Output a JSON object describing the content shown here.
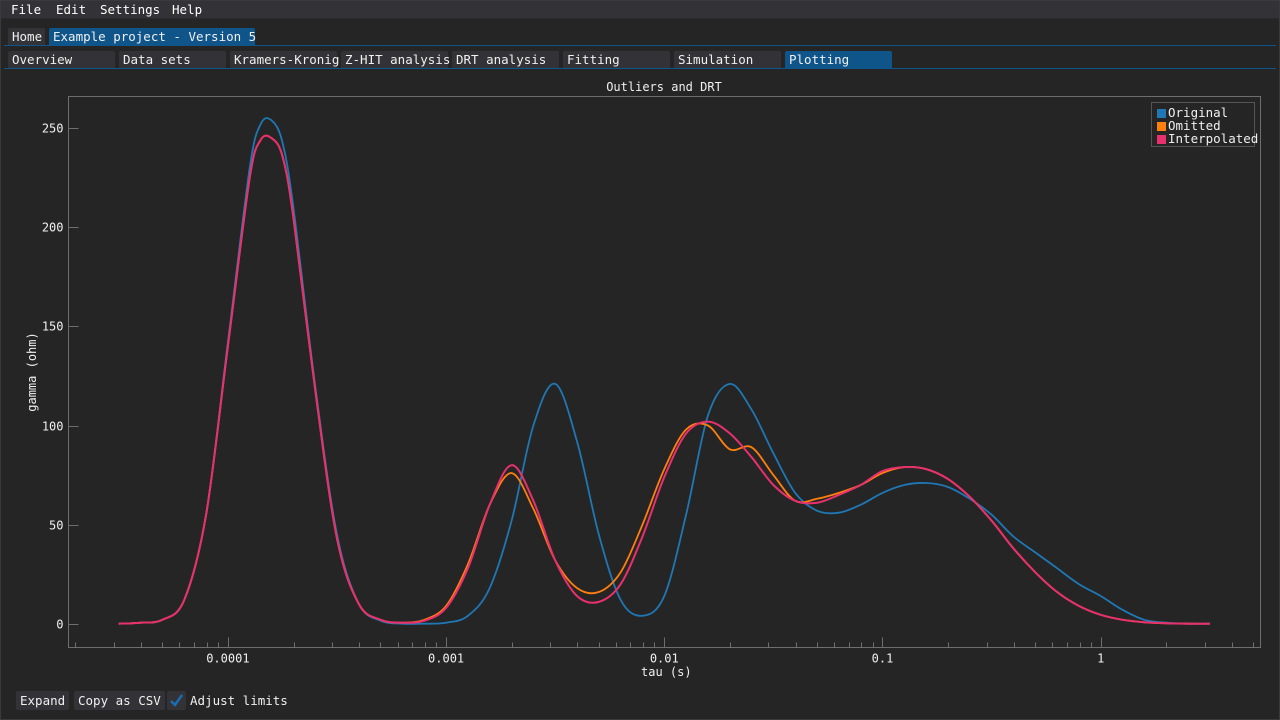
{
  "menu": {
    "items": [
      {
        "label": "File"
      },
      {
        "label": "Edit"
      },
      {
        "label": "Settings"
      },
      {
        "label": "Help"
      }
    ]
  },
  "project_tabs": [
    {
      "label": "Home",
      "active": false
    },
    {
      "label": "Example project - Version 5",
      "active": true
    }
  ],
  "section_tabs": [
    {
      "label": "Overview",
      "active": false
    },
    {
      "label": "Data sets",
      "active": false
    },
    {
      "label": "Kramers-Kronig",
      "active": false
    },
    {
      "label": "Z-HIT analysis",
      "active": false
    },
    {
      "label": "DRT analysis",
      "active": false
    },
    {
      "label": "Fitting",
      "active": false
    },
    {
      "label": "Simulation",
      "active": false
    },
    {
      "label": "Plotting",
      "active": true
    }
  ],
  "bottom_controls": {
    "expand_label": "Expand",
    "copy_csv_label": "Copy as CSV",
    "adjust_limits_label": "Adjust limits",
    "adjust_limits_checked": true
  },
  "colors": {
    "accent": "#10558a",
    "background": "#252525",
    "panel": "#333337"
  },
  "chart_data": {
    "type": "line",
    "title": "Outliers and DRT",
    "xlabel": "tau (s)",
    "ylabel": "gamma (ohm)",
    "xscale": "log",
    "xlim": [
      1.86e-05,
      5.4
    ],
    "ylim": [
      -12,
      266
    ],
    "xticks": [
      0.0001,
      0.001,
      0.01,
      0.1,
      1
    ],
    "xtick_labels": [
      "0.0001",
      "0.001",
      "0.01",
      "0.1",
      "1"
    ],
    "yticks": [
      0,
      50,
      100,
      150,
      200,
      250
    ],
    "ytick_labels": [
      "0",
      "50",
      "100",
      "150",
      "200",
      "250"
    ],
    "grid": false,
    "legend_position": "top-right",
    "log10_tau": [
      -4.5,
      -4.4,
      -4.3,
      -4.2,
      -4.1,
      -4.0,
      -3.9,
      -3.85,
      -3.8,
      -3.75,
      -3.7,
      -3.6,
      -3.5,
      -3.4,
      -3.3,
      -3.2,
      -3.1,
      -3.0,
      -2.9,
      -2.8,
      -2.7,
      -2.6,
      -2.5,
      -2.4,
      -2.3,
      -2.2,
      -2.1,
      -2.0,
      -1.9,
      -1.8,
      -1.7,
      -1.6,
      -1.5,
      -1.4,
      -1.3,
      -1.2,
      -1.1,
      -1.0,
      -0.9,
      -0.8,
      -0.7,
      -0.6,
      -0.5,
      -0.4,
      -0.3,
      -0.2,
      -0.1,
      0.0,
      0.1,
      0.2,
      0.3,
      0.4,
      0.5
    ],
    "series": [
      {
        "name": "Original",
        "color": "#1f77b4",
        "values": [
          0,
          0.5,
          2,
          12,
          55,
          142,
          230,
          252,
          254,
          243,
          210,
          120,
          45,
          10,
          1.5,
          0,
          0,
          0.5,
          4,
          18,
          52,
          100,
          121,
          92,
          45,
          12,
          4,
          14,
          55,
          105,
          121,
          108,
          86,
          66,
          57,
          56,
          60,
          66,
          70,
          71,
          69,
          63,
          55,
          44,
          36,
          28,
          20,
          14,
          7,
          2,
          0.5,
          0,
          0
        ]
      },
      {
        "name": "Omitted",
        "color": "#ff7f0e",
        "values": [
          0,
          0.5,
          2,
          12,
          55,
          140,
          225,
          244,
          245,
          236,
          205,
          118,
          43,
          10,
          2,
          0.5,
          2,
          9,
          30,
          60,
          76,
          58,
          32,
          18,
          16,
          26,
          50,
          78,
          98,
          100,
          88,
          89,
          75,
          62,
          63,
          66,
          70,
          76,
          79,
          78,
          73,
          64,
          52,
          38,
          26,
          16,
          9,
          4.5,
          2,
          0.7,
          0.2,
          0,
          0
        ]
      },
      {
        "name": "Interpolated",
        "color": "#e8306e",
        "values": [
          0,
          0.5,
          2,
          12,
          55,
          140,
          225,
          244,
          245,
          236,
          205,
          118,
          43,
          10,
          2,
          0.5,
          1.5,
          8,
          28,
          60,
          80,
          62,
          32,
          14,
          11,
          20,
          44,
          74,
          96,
          102,
          96,
          84,
          70,
          62,
          61,
          65,
          70,
          77,
          79,
          78,
          73,
          64,
          52,
          38,
          26,
          16,
          9,
          4.5,
          2,
          0.7,
          0.2,
          0,
          0
        ]
      }
    ]
  }
}
